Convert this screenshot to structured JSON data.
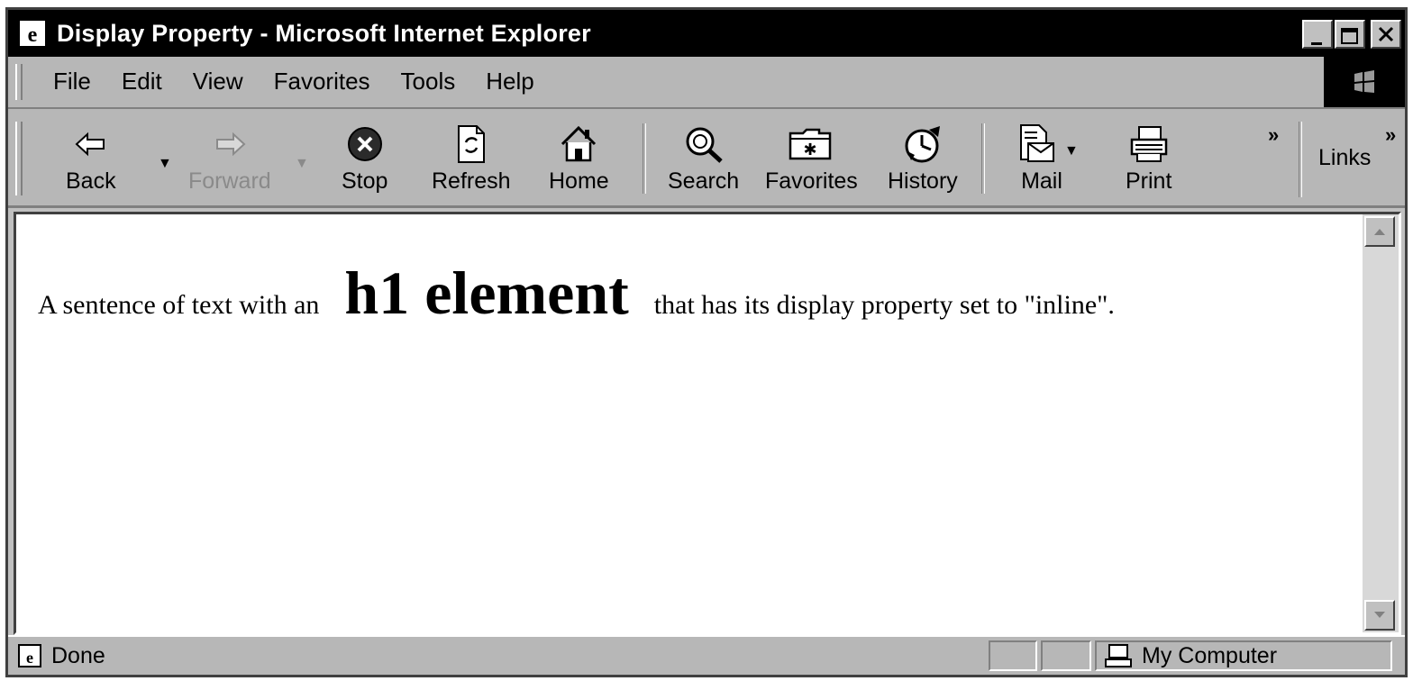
{
  "window": {
    "title": "Display Property - Microsoft Internet Explorer"
  },
  "menu": {
    "items": [
      "File",
      "Edit",
      "View",
      "Favorites",
      "Tools",
      "Help"
    ]
  },
  "toolbar": {
    "back": "Back",
    "forward": "Forward",
    "stop": "Stop",
    "refresh": "Refresh",
    "home": "Home",
    "search": "Search",
    "favorites": "Favorites",
    "history": "History",
    "mail": "Mail",
    "print": "Print",
    "more": "»",
    "links": "Links"
  },
  "document": {
    "before": "A sentence of text with an",
    "heading": "h1 element",
    "after": "that has its display property set to \"inline\"."
  },
  "status": {
    "text": "Done",
    "zone": "My Computer"
  },
  "icons": {
    "app": "ie-logo-icon",
    "back": "back-arrow-icon",
    "forward": "forward-arrow-icon",
    "stop": "stop-icon",
    "refresh": "refresh-icon",
    "home": "home-icon",
    "search": "search-icon",
    "favorites": "favorites-folder-icon",
    "history": "history-icon",
    "mail": "mail-icon",
    "print": "printer-icon",
    "computer": "computer-icon"
  }
}
